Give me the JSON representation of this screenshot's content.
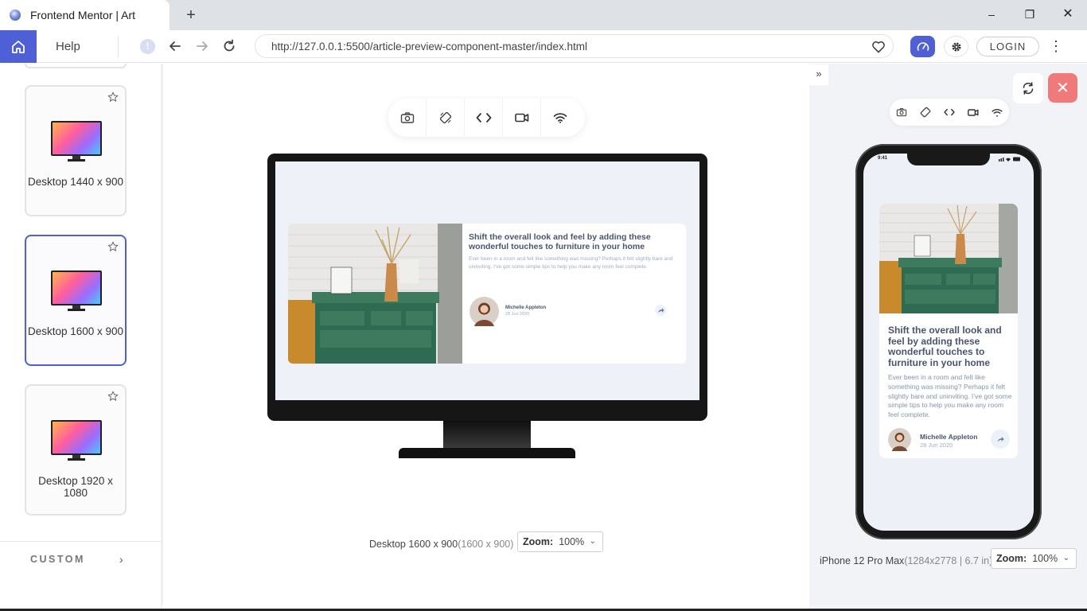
{
  "browser": {
    "tab_title": "Frontend Mentor | Art",
    "new_tab": "+",
    "url": "http://127.0.0.1:5500/article-preview-component-master/index.html",
    "window_controls": {
      "minimize": "–",
      "maximize": "❐",
      "close": "✕"
    }
  },
  "app_toolbar": {
    "help_label": "Help",
    "info_glyph": "!",
    "login_label": "LOGIN",
    "more_glyph": "⋮",
    "accent_color": "#4f5fd5"
  },
  "sidebar": {
    "devices": [
      {
        "label": "Desktop 1440 x 900",
        "selected": false
      },
      {
        "label": "Desktop 1600 x 900",
        "selected": true
      },
      {
        "label": "Desktop 1920 x 1080",
        "selected": false
      }
    ],
    "custom_label": "CUSTOM",
    "custom_chevron": "›"
  },
  "center": {
    "toolbar_icons": [
      "camera-icon",
      "rotate-icon",
      "code-icon",
      "video-icon",
      "wifi-icon"
    ],
    "device_name": "Desktop 1600 x 900",
    "device_res": "(1600 x 900)",
    "zoom_label": "Zoom:",
    "zoom_value": "100%",
    "zoom_chevron": "⌄"
  },
  "article": {
    "title": "Shift the overall look and feel by adding these wonderful touches to furniture in your home",
    "description": "Ever been in a room and felt like something was missing? Perhaps it felt slightly bare and uninviting. I’ve got some simple tips to help you make any room feel complete.",
    "author": "Michelle Appleton",
    "date": "28 Jun 2020"
  },
  "right_panel": {
    "expand_glyph": "»",
    "close_glyph": "✕",
    "status_time": "9:41",
    "device_name": "iPhone 12 Pro Max",
    "device_res": "(1284x2778 | 6.7 in)",
    "zoom_label": "Zoom:",
    "zoom_value": "100%",
    "zoom_chevron": "⌄",
    "close_color": "#f07a7a"
  }
}
